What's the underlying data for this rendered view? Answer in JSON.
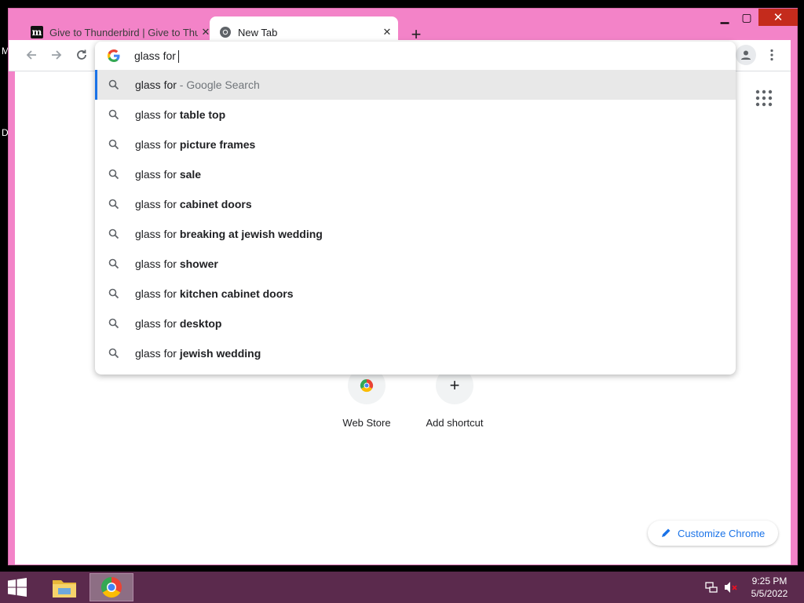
{
  "desktop": {
    "letter_1": "M",
    "letter_2": "D"
  },
  "browser": {
    "tabs": [
      {
        "title": "Give to Thunderbird | Give to Thunderbird",
        "favicon": "m-logo-icon",
        "close_label": "✕"
      },
      {
        "title": "New Tab",
        "favicon": "chrome-icon",
        "close_label": "✕"
      }
    ],
    "new_tab_label": "+",
    "window_controls": {
      "minimize": "▁",
      "maximize": "▢",
      "close": "✕"
    }
  },
  "omnibox": {
    "query": "glass for",
    "suggestions": [
      {
        "prefix": "glass for",
        "bold": "",
        "suffix": " - Google Search",
        "selected": true
      },
      {
        "prefix": "glass for ",
        "bold": "table top",
        "suffix": ""
      },
      {
        "prefix": "glass for ",
        "bold": "picture frames",
        "suffix": ""
      },
      {
        "prefix": "glass for ",
        "bold": "sale",
        "suffix": ""
      },
      {
        "prefix": "glass for ",
        "bold": "cabinet doors",
        "suffix": ""
      },
      {
        "prefix": "glass for ",
        "bold": "breaking at jewish wedding",
        "suffix": ""
      },
      {
        "prefix": "glass for ",
        "bold": "shower",
        "suffix": ""
      },
      {
        "prefix": "glass for ",
        "bold": "kitchen cabinet doors",
        "suffix": ""
      },
      {
        "prefix": "glass for ",
        "bold": "desktop",
        "suffix": ""
      },
      {
        "prefix": "glass for ",
        "bold": "jewish wedding",
        "suffix": ""
      }
    ]
  },
  "new_tab_page": {
    "shortcuts": [
      {
        "label": "Web Store",
        "icon": "chrome-web-store-icon"
      },
      {
        "label": "Add shortcut",
        "icon": "plus-icon",
        "symbol": "+"
      }
    ],
    "customize_label": "Customize Chrome"
  },
  "taskbar": {
    "time": "9:25 PM",
    "date": "5/5/2022"
  },
  "colors": {
    "window_frame": "#f383c8",
    "taskbar": "#5b2a4d",
    "accent": "#1a73e8"
  }
}
